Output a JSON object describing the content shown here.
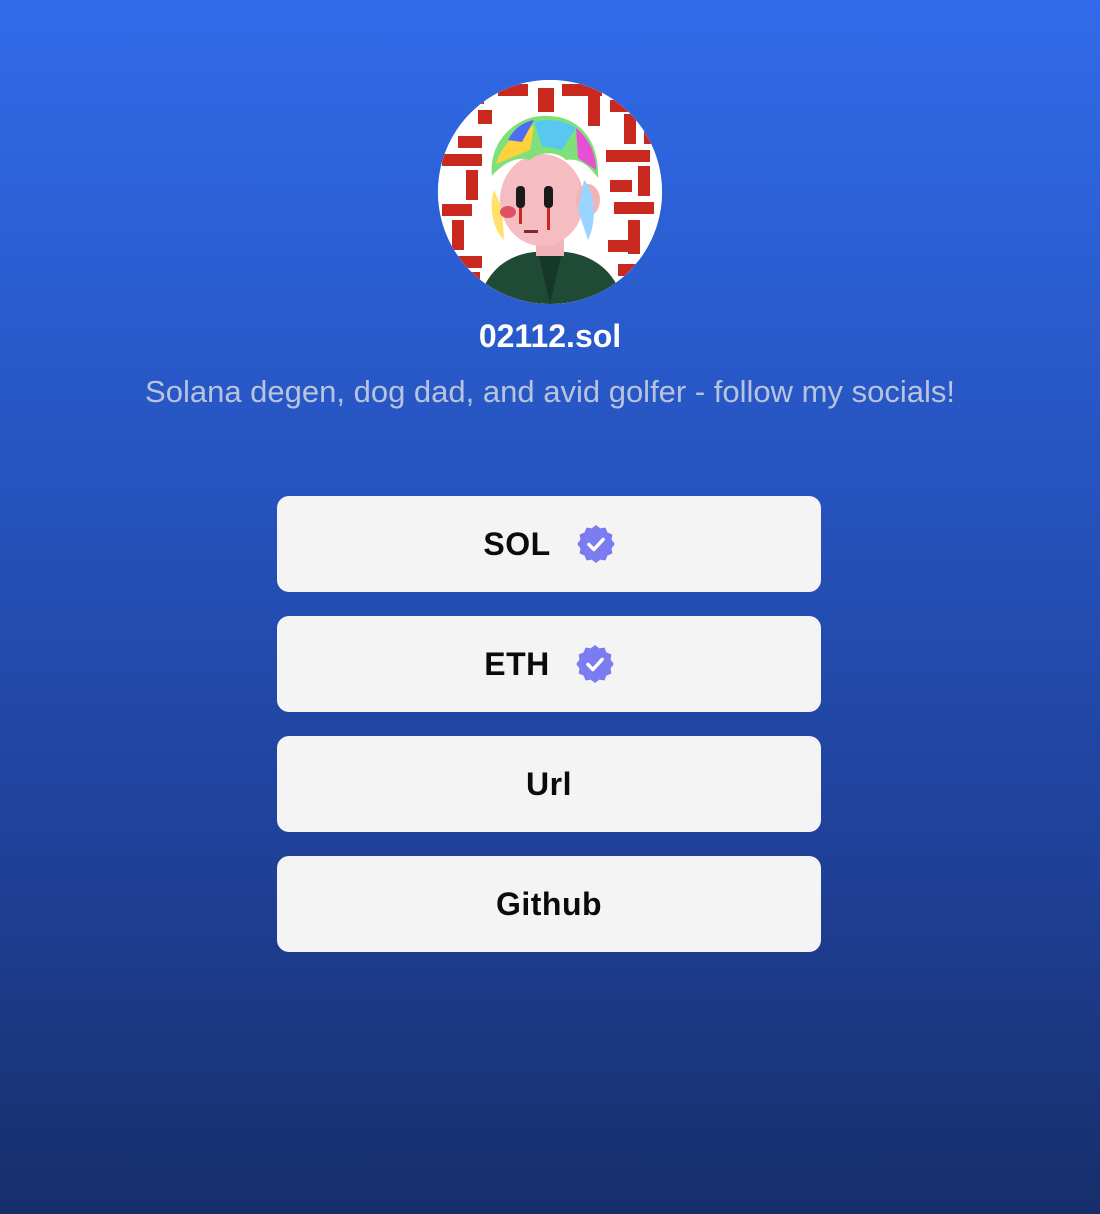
{
  "profile": {
    "username": "02112.sol",
    "bio": "Solana degen, dog dad, and avid golfer - follow my socials!",
    "avatar_icon": "nft-avatar-image"
  },
  "links": [
    {
      "label": "SOL",
      "verified": true,
      "icon": "verified-badge-icon"
    },
    {
      "label": "ETH",
      "verified": true,
      "icon": "verified-badge-icon"
    },
    {
      "label": "Url",
      "verified": false
    },
    {
      "label": "Github",
      "verified": false
    }
  ],
  "colors": {
    "background_top": "#316bea",
    "background_bottom": "#172e6a",
    "button_bg": "#f4f4f5",
    "button_text": "#0b0b0b",
    "verified_badge": "#7b7cf0",
    "bio_text": "#b8c3dd",
    "username_text": "#ffffff"
  }
}
